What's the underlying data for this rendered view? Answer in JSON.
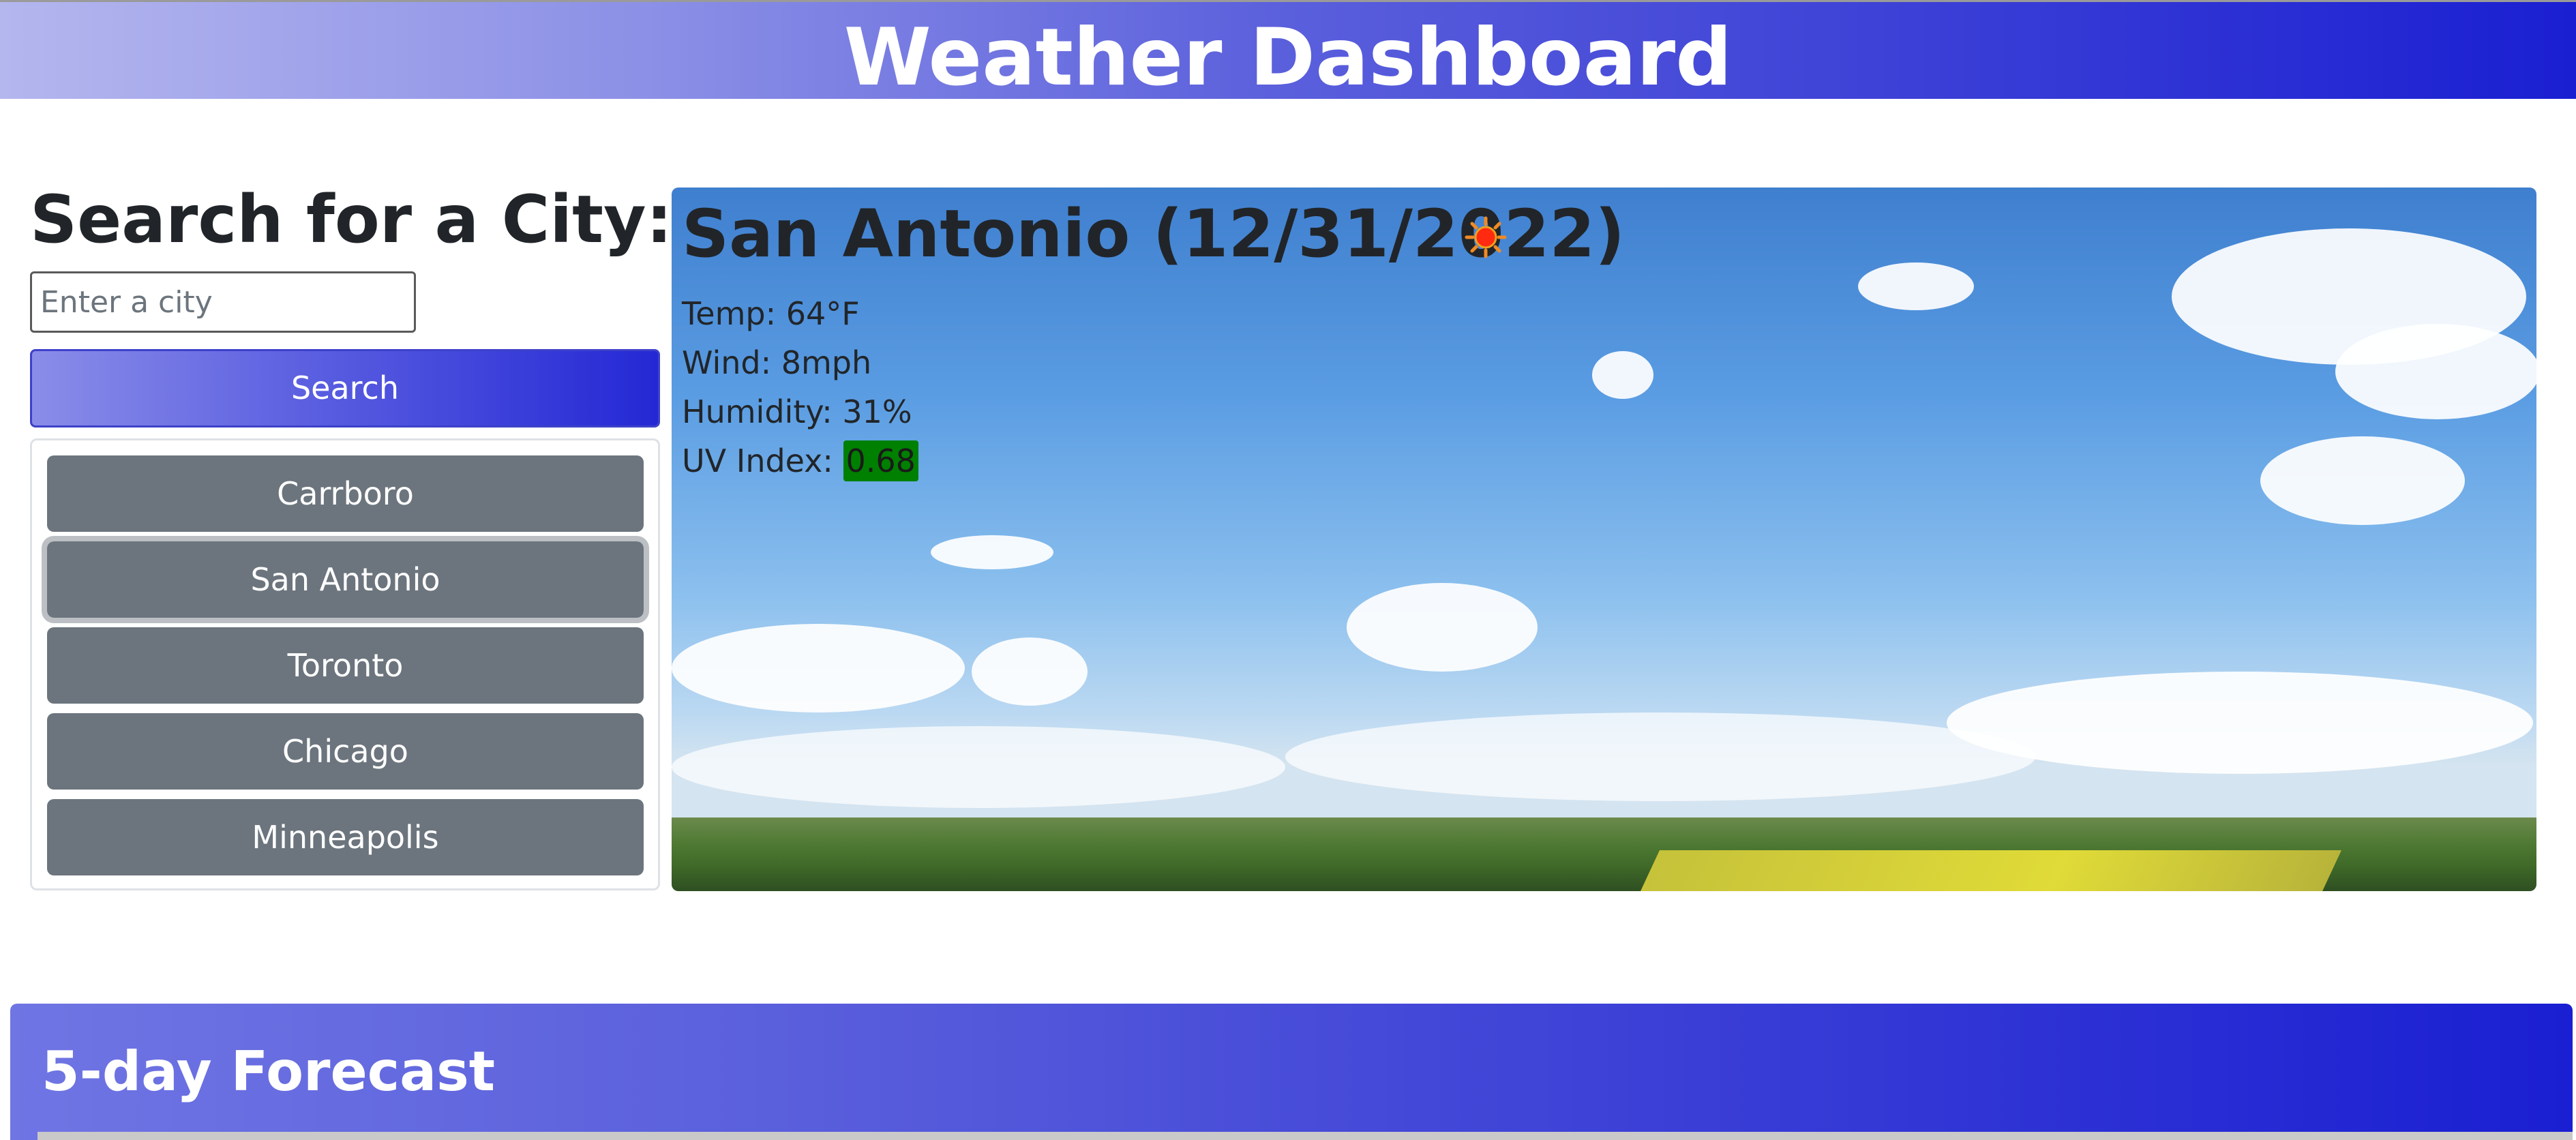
{
  "header": {
    "title": "Weather Dashboard"
  },
  "search": {
    "title": "Search for a City:",
    "placeholder": "Enter a city",
    "button_label": "Search"
  },
  "history": {
    "items": [
      {
        "label": "Carrboro"
      },
      {
        "label": "San Antonio"
      },
      {
        "label": "Toronto"
      },
      {
        "label": "Chicago"
      },
      {
        "label": "Minneapolis"
      }
    ],
    "active_index": 1
  },
  "current": {
    "title": "San Antonio (12/31/2022)",
    "icon": "sun-icon",
    "temp": "Temp: 64°F",
    "wind": "Wind: 8mph",
    "humidity": "Humidity: 31%",
    "uv_label": "UV Index: ",
    "uv_value": "0.68",
    "uv_color": "#008000"
  },
  "forecast": {
    "title": "5-day Forecast"
  },
  "colors": {
    "accent_start": "#b4b6ee",
    "accent_end": "#1a1fd2",
    "history_button": "#6c757d"
  }
}
